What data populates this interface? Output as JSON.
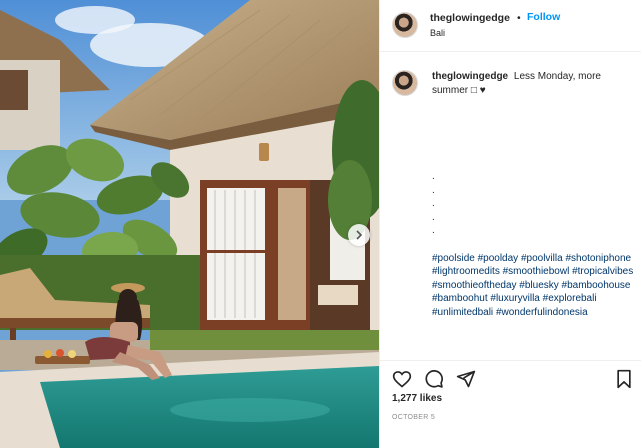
{
  "post": {
    "username": "theglowingedge",
    "follow_label": "Follow",
    "separator": "•",
    "location": "Bali"
  },
  "caption": {
    "username": "theglowingedge",
    "text": "Less Monday, more summer □ ♥",
    "dots": [
      ".",
      ".",
      ".",
      ".",
      "."
    ],
    "hashtags": [
      "#poolside",
      "#poolday",
      "#poolvilla",
      "#shotoniphone",
      "#lightroomedits",
      "#smoothiebowl",
      "#tropicalvibes",
      "#smoothieoftheday",
      "#bluesky",
      "#bamboohouse",
      "#bamboohut",
      "#luxuryvilla",
      "#explorebali",
      "#unlimitedbali",
      "#wonderfulindonesia"
    ]
  },
  "actions": {
    "likes": "1,277 likes",
    "date": "October 5",
    "icons": [
      "heart-icon",
      "comment-icon",
      "share-icon",
      "bookmark-icon"
    ]
  },
  "colors": {
    "link_blue": "#0095f6",
    "hashtag_blue": "#00376b",
    "muted": "#8e8e8e",
    "text": "#262626"
  }
}
